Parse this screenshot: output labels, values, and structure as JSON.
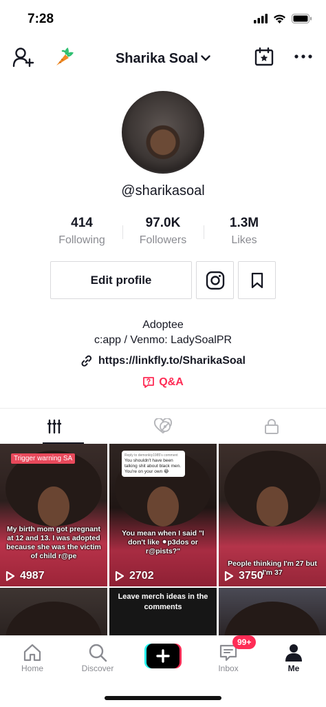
{
  "status_bar": {
    "time": "7:28"
  },
  "header": {
    "title": "Sharika Soal"
  },
  "profile": {
    "username": "@sharikasoal",
    "stats": [
      {
        "value": "414",
        "label": "Following"
      },
      {
        "value": "97.0K",
        "label": "Followers"
      },
      {
        "value": "1.3M",
        "label": "Likes"
      }
    ],
    "edit_label": "Edit profile",
    "bio_lines": [
      "Adoptee",
      "c:app / Venmo: LadySoalPR"
    ],
    "link": "https://linkfly.to/SharikaSoal",
    "qa_label": "Q&A"
  },
  "videos": [
    {
      "badge": "Trigger warning SA",
      "caption": "My birth mom got pregnant at 12 and 13. I was adopted because she was the victim of child r@pe",
      "views": "4987"
    },
    {
      "comment_meta": "Reply to demonkiy1985's comment",
      "comment_text": "You shouldn't have been talking shit about black men. You're on your own 😂",
      "caption": "You mean when I said \"I don't like ⚫p3dos or r@pists?\"",
      "views": "2702"
    },
    {
      "caption": "People thinking I'm 27 but I'm 37",
      "views": "3750"
    },
    {
      "caption": ""
    },
    {
      "caption": "Leave merch ideas in the comments"
    },
    {
      "caption": ""
    }
  ],
  "bottom_nav": {
    "home": "Home",
    "discover": "Discover",
    "inbox": "Inbox",
    "inbox_badge": "99+",
    "me": "Me"
  },
  "colors": {
    "accent": "#fe2c55",
    "text": "#161823",
    "muted": "#8a8b91"
  }
}
